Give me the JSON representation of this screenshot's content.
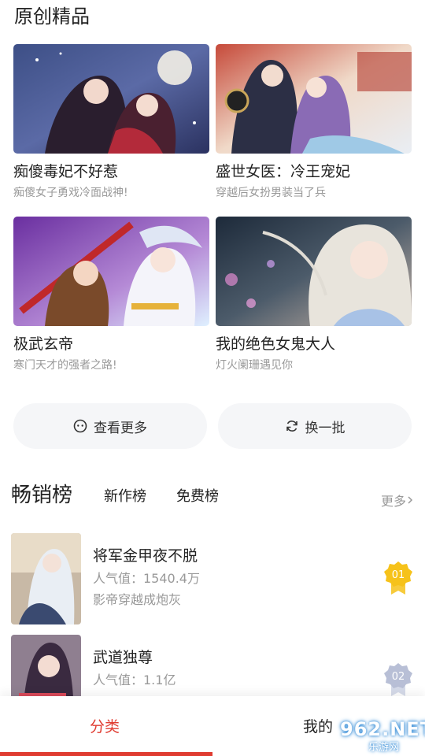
{
  "section": {
    "title": "原创精品"
  },
  "featured": [
    {
      "title": "痴傻毒妃不好惹",
      "desc": "痴傻女子勇戏冷面战神!"
    },
    {
      "title": "盛世女医：冷王宠妃",
      "desc": "穿越后女扮男装当了兵"
    },
    {
      "title": "极武玄帝",
      "desc": "寒门天才的强者之路!"
    },
    {
      "title": "我的绝色女鬼大人",
      "desc": "灯火阑珊遇见你"
    }
  ],
  "actions": {
    "more_label": "查看更多",
    "refresh_label": "换一批"
  },
  "ranking": {
    "active_tab": "畅销榜",
    "tabs": [
      "新作榜",
      "免费榜"
    ],
    "more": "更多"
  },
  "rank_items": [
    {
      "title": "将军金甲夜不脱",
      "popularity": "人气值：1540.4万",
      "summary": "影帝穿越成炮灰",
      "rank": "01"
    },
    {
      "title": "武道独尊",
      "popularity": "人气值：1.1亿",
      "summary": "",
      "rank": "02"
    }
  ],
  "bottom_nav": {
    "category": "分类",
    "mine": "我的"
  },
  "watermark": {
    "brand": "962.NET",
    "site": "乐游网"
  },
  "colors": {
    "accent": "#e03c31",
    "gold": "#f6c21a",
    "silver": "#b8bfd6"
  }
}
